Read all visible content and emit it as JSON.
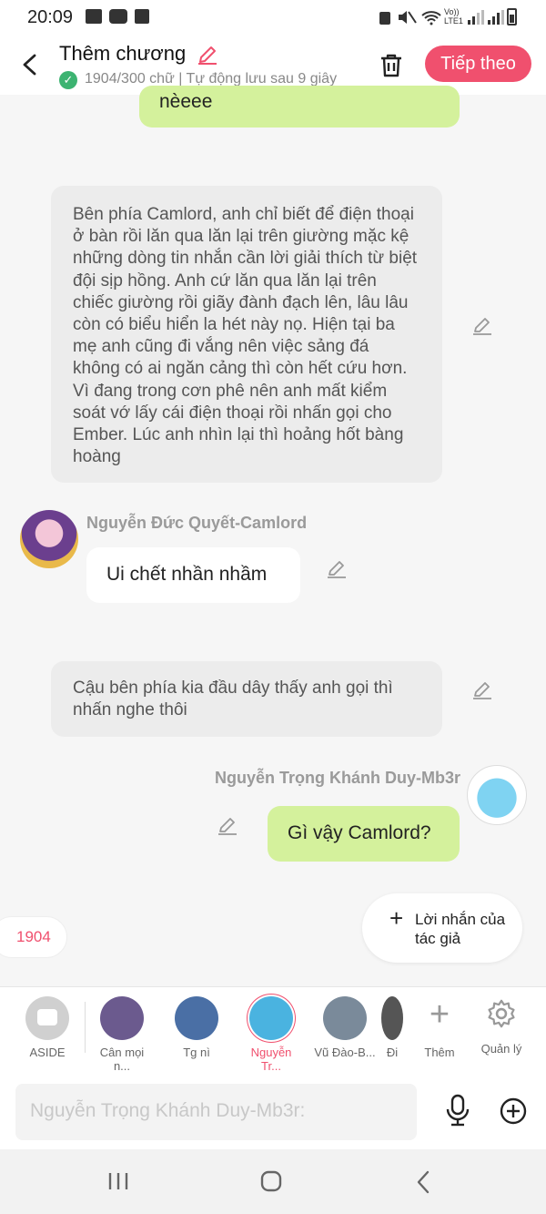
{
  "status_bar": {
    "time": "20:09",
    "network_label": "Vo)) LTE1"
  },
  "header": {
    "title": "Thêm chương",
    "subtitle": "1904/300 chữ | Tự động lưu sau 9 giây",
    "next_label": "Tiếp theo"
  },
  "messages": [
    {
      "type": "partial",
      "text": "nèeee"
    },
    {
      "type": "narration",
      "text": "Bên phía Camlord, anh chỉ biết để điện thoại ở bàn rồi lăn qua lăn lại trên giường mặc kệ những dòng tin nhắn cần lời giải thích từ biệt đội sịp hồng. Anh cứ lăn qua lăn lại trên chiếc giường rồi giãy đành đạch lên, lâu lâu còn có biểu hiển la hét này nọ. Hiện tại ba mẹ anh cũng đi vắng nên việc sảng đá không có ai ngăn cảng thì còn hết cứu hơn. Vì đang trong cơn phê nên anh mất kiểm soát vớ lấy cái điện thoại rồi nhấn gọi cho Ember. Lúc anh nhìn lại thì hoảng hốt bàng hoàng"
    },
    {
      "type": "left",
      "name": "Nguyễn Đức Quyết-Camlord",
      "text": "Ui chết nhần nhầm"
    },
    {
      "type": "narration",
      "text": "Cậu bên phía kia đầu dây thấy anh gọi thì nhấn nghe thôi"
    },
    {
      "type": "right",
      "name": "Nguyễn Trọng Khánh Duy-Mb3r",
      "text": "Gì vậy Camlord?"
    }
  ],
  "word_count_badge": "1904",
  "author_note_label": "Lời nhắn của tác giả",
  "characters": [
    {
      "label": "ASIDE",
      "color": "#9a9a9a"
    },
    {
      "label": "Cân mọi n...",
      "color": "#6b5a8e"
    },
    {
      "label": "Tg nì",
      "color": "#4a6fa5"
    },
    {
      "label": "Nguyễn Tr...",
      "color": "#4ab3e0",
      "selected": true
    },
    {
      "label": "Vũ Đào-B...",
      "color": "#7a8a9a"
    },
    {
      "label": "Đi",
      "color": "#555555"
    }
  ],
  "actions": {
    "more_label": "Thêm",
    "manage_label": "Quản lý"
  },
  "input": {
    "placeholder": "Nguyễn Trọng Khánh Duy-Mb3r:"
  },
  "colors": {
    "accent": "#f0506e",
    "right_bubble": "#d4f19c",
    "narration_bg": "#ececec"
  }
}
